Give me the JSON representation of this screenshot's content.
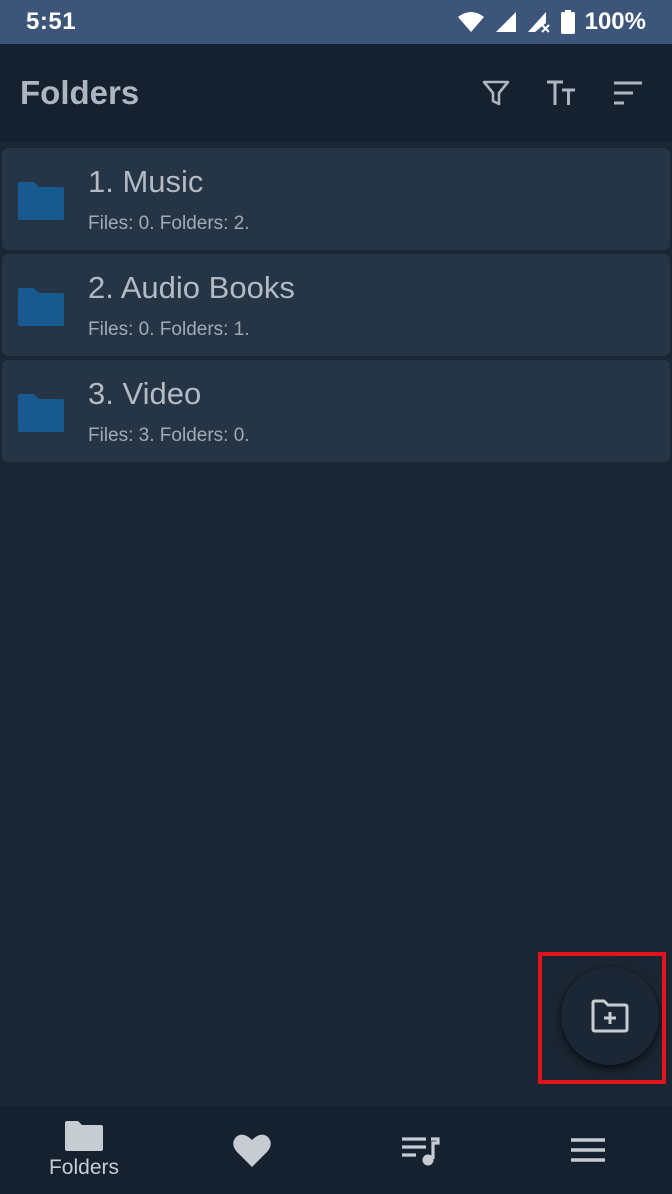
{
  "status_bar": {
    "time": "5:51",
    "battery": "100%",
    "icons": [
      "wifi-icon",
      "signal-icon",
      "signal-no-data-icon",
      "battery-icon"
    ]
  },
  "app_bar": {
    "title": "Folders",
    "actions": [
      "filter-icon",
      "text-size-icon",
      "sort-icon"
    ]
  },
  "folders": [
    {
      "name": "1. Music",
      "meta": "Files: 0. Folders: 2."
    },
    {
      "name": "2. Audio Books",
      "meta": "Files: 0. Folders: 1."
    },
    {
      "name": "3. Video",
      "meta": "Files: 3. Folders: 0."
    }
  ],
  "fab": {
    "icon": "create-new-folder-icon"
  },
  "bottom_nav": {
    "items": [
      {
        "icon": "folder-icon",
        "label": "Folders"
      },
      {
        "icon": "heart-icon",
        "label": ""
      },
      {
        "icon": "playlist-icon",
        "label": ""
      },
      {
        "icon": "menu-icon",
        "label": ""
      }
    ]
  },
  "colors": {
    "status_bar": "#3c5579",
    "app_bar": "#162130",
    "background": "#1b2634",
    "list_item": "#263546",
    "folder_icon": "#175a8f",
    "highlight": "#e0141a"
  }
}
